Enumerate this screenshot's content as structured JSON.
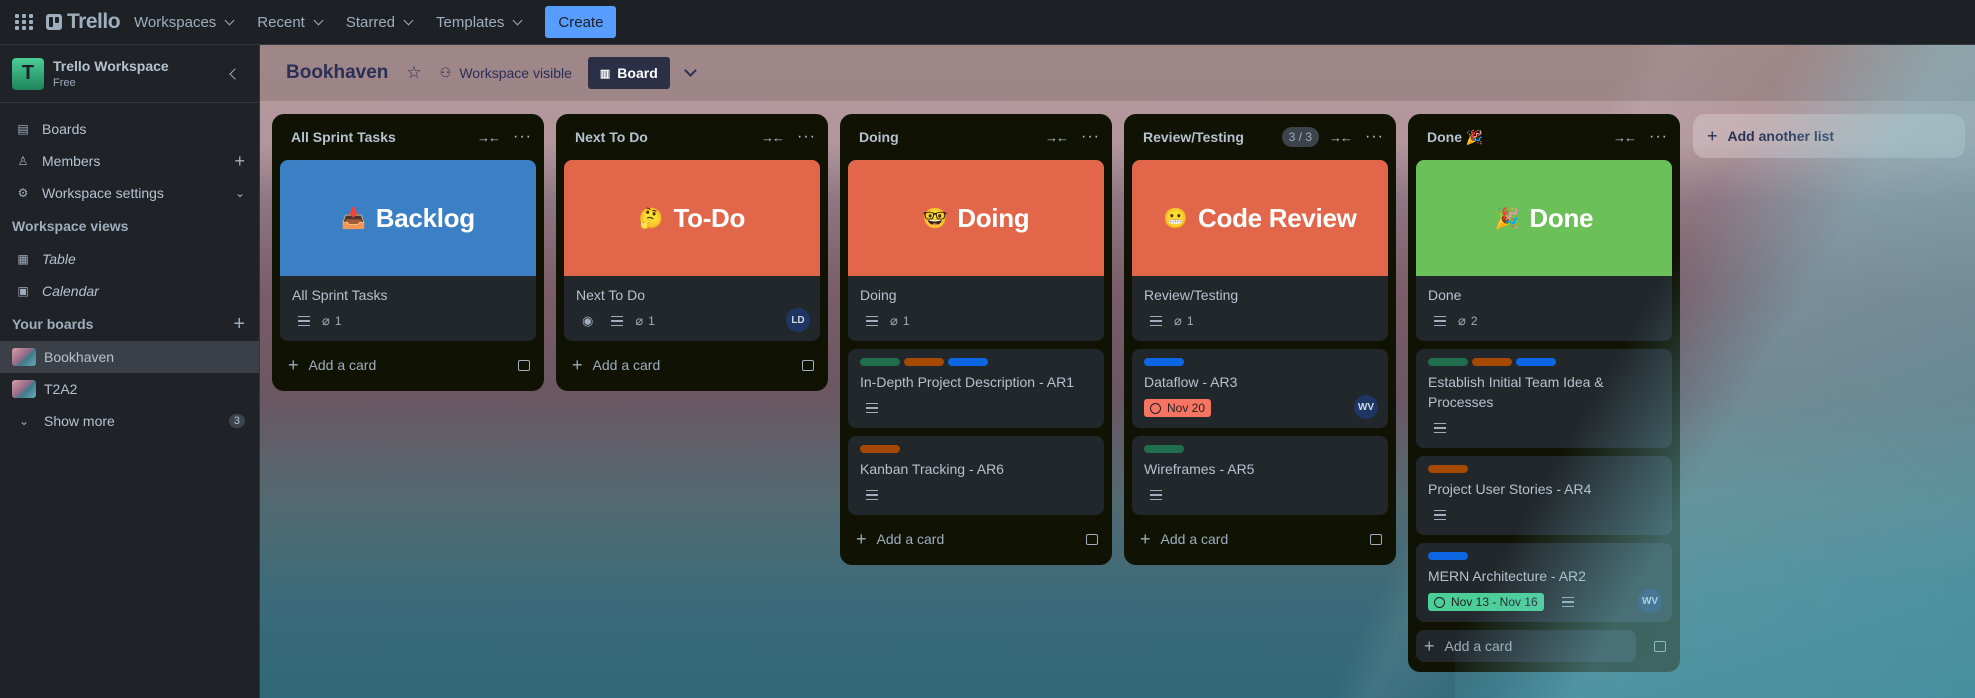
{
  "topbar": {
    "apps_icon": "grid-icon",
    "logo_text": "Trello",
    "nav": [
      "Workspaces",
      "Recent",
      "Starred",
      "Templates"
    ],
    "create_label": "Create"
  },
  "sidebar": {
    "workspace_initial": "T",
    "workspace_name": "Trello Workspace",
    "workspace_plan": "Free",
    "items": [
      {
        "label": "Boards",
        "icon": "board-icon"
      },
      {
        "label": "Members",
        "icon": "person-icon",
        "action": "+"
      },
      {
        "label": "Workspace settings",
        "icon": "gear-icon",
        "action": "chevron"
      }
    ],
    "views_title": "Workspace views",
    "views": [
      {
        "label": "Table",
        "icon": "table-icon"
      },
      {
        "label": "Calendar",
        "icon": "calendar-icon"
      }
    ],
    "boards_title": "Your boards",
    "boards": [
      "Bookhaven",
      "T2A2"
    ],
    "show_more_label": "Show more",
    "show_more_count": "3"
  },
  "board": {
    "title": "Bookhaven",
    "visibility_label": "Workspace visible",
    "view_label": "Board",
    "add_list_label": "Add another list",
    "add_card_label": "Add a card"
  },
  "colors": {
    "label_green": "#216e4e",
    "label_orange": "#a54800",
    "label_blue": "#0c66e4",
    "cover_blue": "#3b7fc4",
    "cover_red": "#e2674a",
    "cover_green": "#6cc05a",
    "date_red": "#f87462",
    "date_green": "#4bce97"
  },
  "lists": [
    {
      "title": "All Sprint Tasks",
      "cards": [
        {
          "cover_emoji": "📥",
          "cover_text": "Backlog",
          "cover_color": "#3b7fc4",
          "title": "All Sprint Tasks",
          "attachments": "1"
        }
      ]
    },
    {
      "title": "Next To Do",
      "cards": [
        {
          "cover_emoji": "🤔",
          "cover_text": "To-Do",
          "cover_color": "#e2674a",
          "title": "Next To Do",
          "attachments": "1",
          "avatar": "LD"
        }
      ]
    },
    {
      "title": "Doing",
      "cards": [
        {
          "cover_emoji": "🤓",
          "cover_text": "Doing",
          "cover_color": "#e2674a",
          "title": "Doing",
          "attachments": "1"
        },
        {
          "title": "In-Depth Project Description - AR1"
        },
        {
          "title": "Kanban Tracking - AR6"
        }
      ]
    },
    {
      "title": "Review/Testing",
      "wip": "3 / 3",
      "cards": [
        {
          "cover_emoji": "😬",
          "cover_text": "Code Review",
          "cover_color": "#e2674a",
          "title": "Review/Testing",
          "attachments": "1"
        },
        {
          "title": "Dataflow - AR3",
          "due": "Nov 20",
          "avatar": "WV"
        },
        {
          "title": "Wireframes - AR5"
        }
      ]
    },
    {
      "title": "Done 🎉",
      "cards": [
        {
          "cover_emoji": "🎉",
          "cover_text": "Done",
          "cover_color": "#6cc05a",
          "title": "Done",
          "attachments": "2"
        },
        {
          "title": "Establish Initial Team Idea & Processes"
        },
        {
          "title": "Project User Stories - AR4"
        },
        {
          "title": "MERN Architecture - AR2",
          "dates": "Nov 13 - Nov 16",
          "avatar": "WV"
        }
      ]
    }
  ]
}
